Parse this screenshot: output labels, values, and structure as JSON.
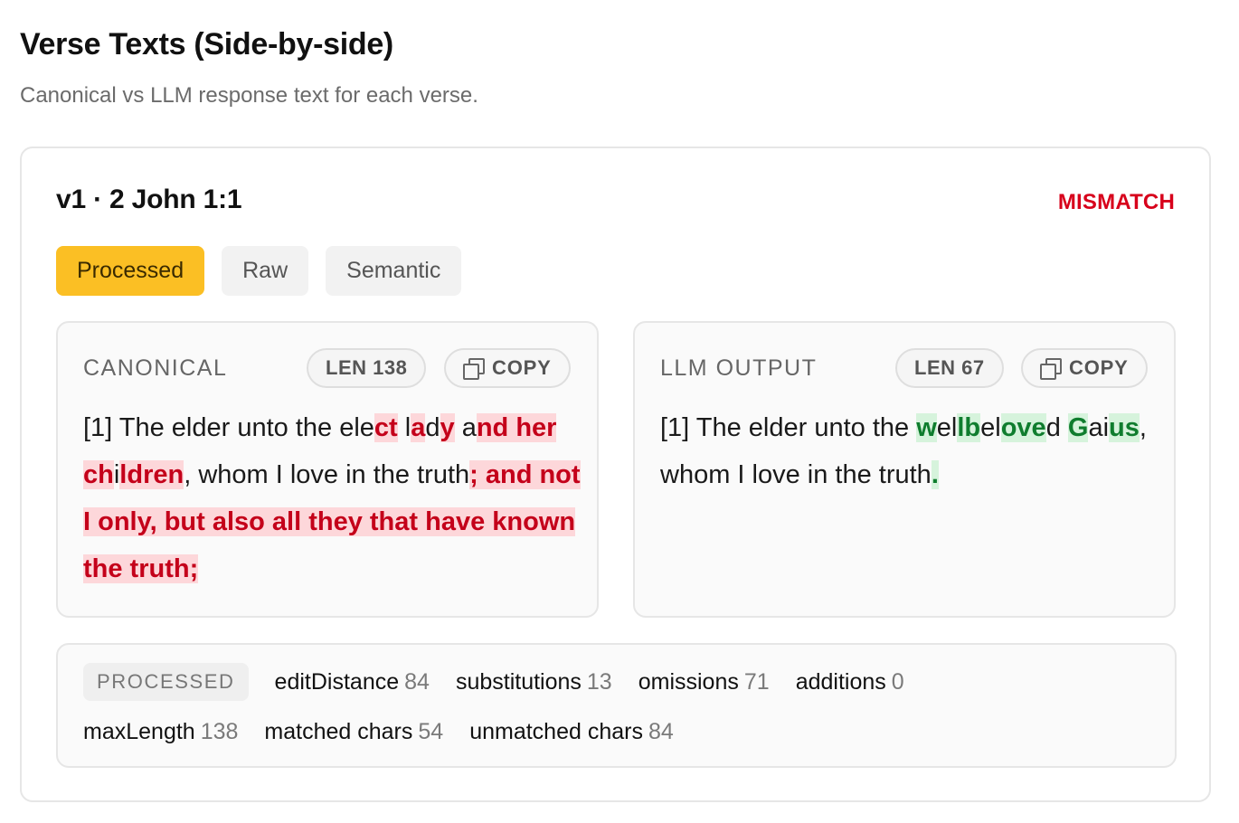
{
  "page": {
    "title": "Verse Texts (Side-by-side)",
    "subtitle": "Canonical vs LLM response text for each verse."
  },
  "verse": {
    "ref": "v1 · 2 John 1:1",
    "status": "MISMATCH",
    "status_color": "#d7001b"
  },
  "tabs": [
    {
      "label": "Processed",
      "active": true
    },
    {
      "label": "Raw",
      "active": false
    },
    {
      "label": "Semantic",
      "active": false
    }
  ],
  "canonical": {
    "label": "CANONICAL",
    "len": "LEN 138",
    "copy": "COPY",
    "segments": [
      {
        "t": "[1] The elder unto the ele",
        "k": "eq"
      },
      {
        "t": "ct",
        "k": "del"
      },
      {
        "t": " l",
        "k": "eq"
      },
      {
        "t": "a",
        "k": "del"
      },
      {
        "t": "d",
        "k": "eq"
      },
      {
        "t": "y",
        "k": "del"
      },
      {
        "t": " a",
        "k": "eq"
      },
      {
        "t": "nd her ch",
        "k": "del"
      },
      {
        "t": "i",
        "k": "eq"
      },
      {
        "t": "ldren",
        "k": "del"
      },
      {
        "t": ", whom I love in the truth",
        "k": "eq"
      },
      {
        "t": "; and not I only, but also all they that have known the truth;",
        "k": "del"
      }
    ]
  },
  "llm": {
    "label": "LLM OUTPUT",
    "len": "LEN 67",
    "copy": "COPY",
    "segments": [
      {
        "t": "[1] The elder unto the ",
        "k": "eq"
      },
      {
        "t": "w",
        "k": "ins"
      },
      {
        "t": "el",
        "k": "eq"
      },
      {
        "t": "lb",
        "k": "ins"
      },
      {
        "t": "el",
        "k": "eq"
      },
      {
        "t": "ove",
        "k": "ins"
      },
      {
        "t": "d ",
        "k": "eq"
      },
      {
        "t": "G",
        "k": "ins"
      },
      {
        "t": "ai",
        "k": "eq"
      },
      {
        "t": "us",
        "k": "ins"
      },
      {
        "t": ", whom I love in the truth",
        "k": "eq"
      },
      {
        "t": ".",
        "k": "ins"
      }
    ]
  },
  "metrics": {
    "mode": "PROCESSED",
    "edit_distance": {
      "name": "editDistance",
      "value": "84"
    },
    "substitutions": {
      "name": "substitutions",
      "value": "13"
    },
    "omissions": {
      "name": "omissions",
      "value": "71"
    },
    "additions": {
      "name": "additions",
      "value": "0"
    },
    "max_length": {
      "name": "maxLength",
      "value": "138"
    },
    "matched": {
      "name": "matched chars",
      "value": "54"
    },
    "unmatched": {
      "name": "unmatched chars",
      "value": "84"
    }
  },
  "colors": {
    "accent_tab": "#fbbf24",
    "deletion_bg": "#fdd7da",
    "deletion_text": "#c4001a",
    "insertion_bg": "#d6f3dc",
    "insertion_text": "#0f7d2e"
  }
}
